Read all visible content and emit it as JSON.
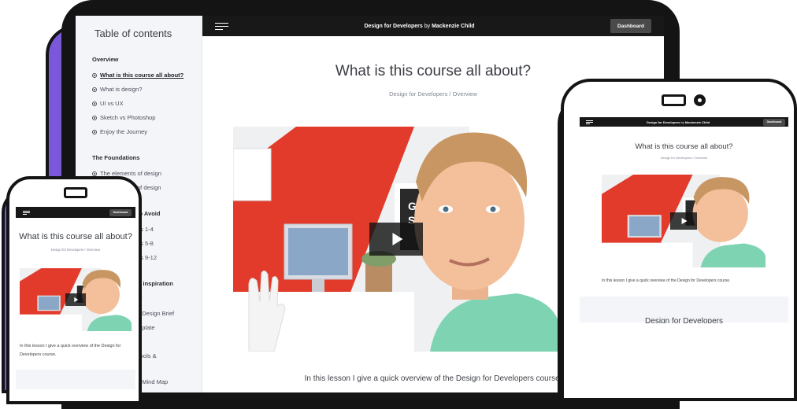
{
  "course": {
    "title": "Design for Developers",
    "by": "by",
    "author": "Mackenzie Child",
    "dashboard_label": "Dashboard"
  },
  "lesson": {
    "title": "What is this course all about?",
    "breadcrumb_course": "Design for Developers",
    "breadcrumb_separator": "/",
    "breadcrumb_section": "Overview",
    "description": "In this lesson I give a quick overview of the Design for Developers course.",
    "description_phone_line1": "In this lesson I give a quick overview of the Design for",
    "description_phone_line2": "Developers course."
  },
  "sidebar": {
    "title": "Table of contents",
    "sections": [
      {
        "name": "Overview",
        "items": [
          "What is this course all about?",
          "What is design?",
          "UI vs UX",
          "Sketch vs Photoshop",
          "Enjoy the Journey"
        ]
      },
      {
        "name": "The Foundations",
        "items": [
          "The elements of design",
          "of design"
        ]
      },
      {
        "name": "to Avoid",
        "items": [
          "es 1-4",
          "es 5-8",
          "es 9-12"
        ]
      },
      {
        "name": "& inspiration",
        "items": [
          "ef",
          "n Design Brief",
          "mplate"
        ]
      },
      {
        "name": "",
        "items": [
          "Tools &",
          "n Mind Map"
        ]
      }
    ]
  },
  "tablet_footer_title": "Design for Developers",
  "video_art": {
    "poster_text_1": "GET",
    "poster_text_2": "SHIT"
  },
  "colors": {
    "accent_purple": "#7b57d9",
    "frame": "#141414",
    "navbar": "#181818",
    "sidebar_bg": "#f3f5f9"
  },
  "icons": [
    "menu-icon",
    "play-icon",
    "bullet-icon",
    "camera-icon",
    "speaker-icon"
  ]
}
